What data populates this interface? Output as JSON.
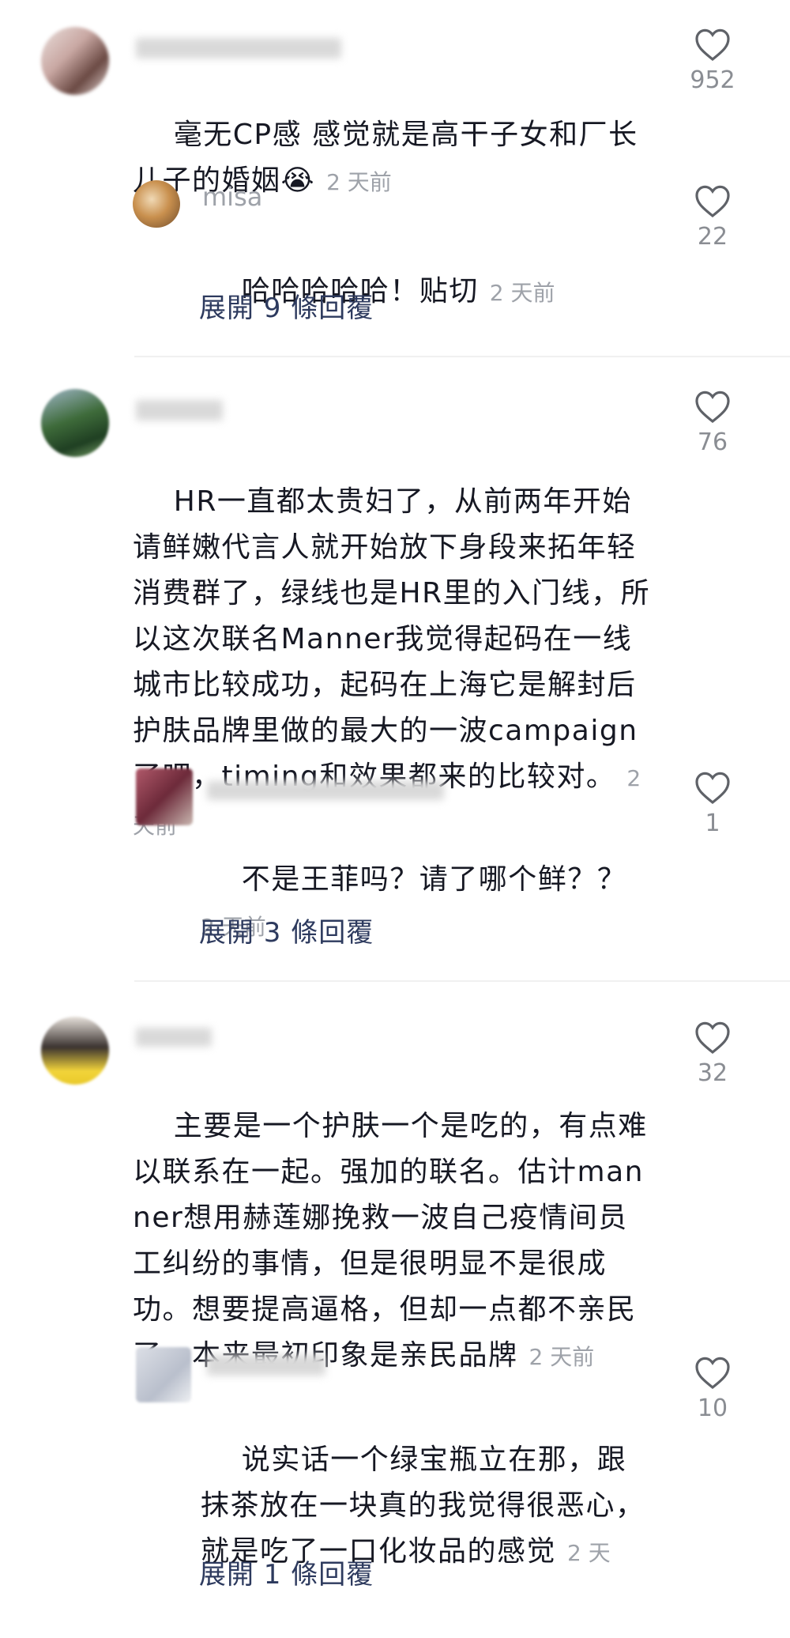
{
  "comments": [
    {
      "text": "毫无CP感 感觉就是高干子女和厂长儿子的婚姻😭",
      "time": "2 天前",
      "likes": "952",
      "replies": [
        {
          "username": "misa",
          "text": "哈哈哈哈哈！贴切",
          "time": "2 天前",
          "likes": "22"
        }
      ],
      "expand_label": "展開 9 條回覆"
    },
    {
      "text": "HR一直都太贵妇了，从前两年开始请鲜嫩代言人就开始放下身段来拓年轻消费群了，绿线也是HR里的入门线，所以这次联名Manner我觉得起码在一线城市比较成功，起码在上海它是解封后护肤品牌里做的最大的一波campaign了吧，timing和效果都来的比较对。",
      "time": "2 天前",
      "likes": "76",
      "replies": [
        {
          "text": "不是王菲吗？请了哪个鲜？？",
          "time": "2 天前",
          "likes": "1"
        }
      ],
      "expand_label": "展開 3 條回覆"
    },
    {
      "text": "主要是一个护肤一个是吃的，有点难以联系在一起。强加的联名。估计manner想用赫莲娜挽救一波自己疫情间员工纠纷的事情，但是很明显不是很成功。想要提高逼格，但却一点都不亲民了。本来最初印象是亲民品牌",
      "time": "2 天前",
      "likes": "32",
      "replies": [
        {
          "text": "说实话一个绿宝瓶立在那，跟抹茶放在一块真的我觉得很恶心，就是吃了一口化妆品的感觉",
          "time": "2 天",
          "likes": "10"
        }
      ],
      "expand_label": "展開 1 條回覆"
    }
  ],
  "icons": {
    "like": "heart-outline-icon"
  },
  "colors": {
    "text": "#161823",
    "muted": "#9ea2a9",
    "link": "#2d3a5e"
  }
}
